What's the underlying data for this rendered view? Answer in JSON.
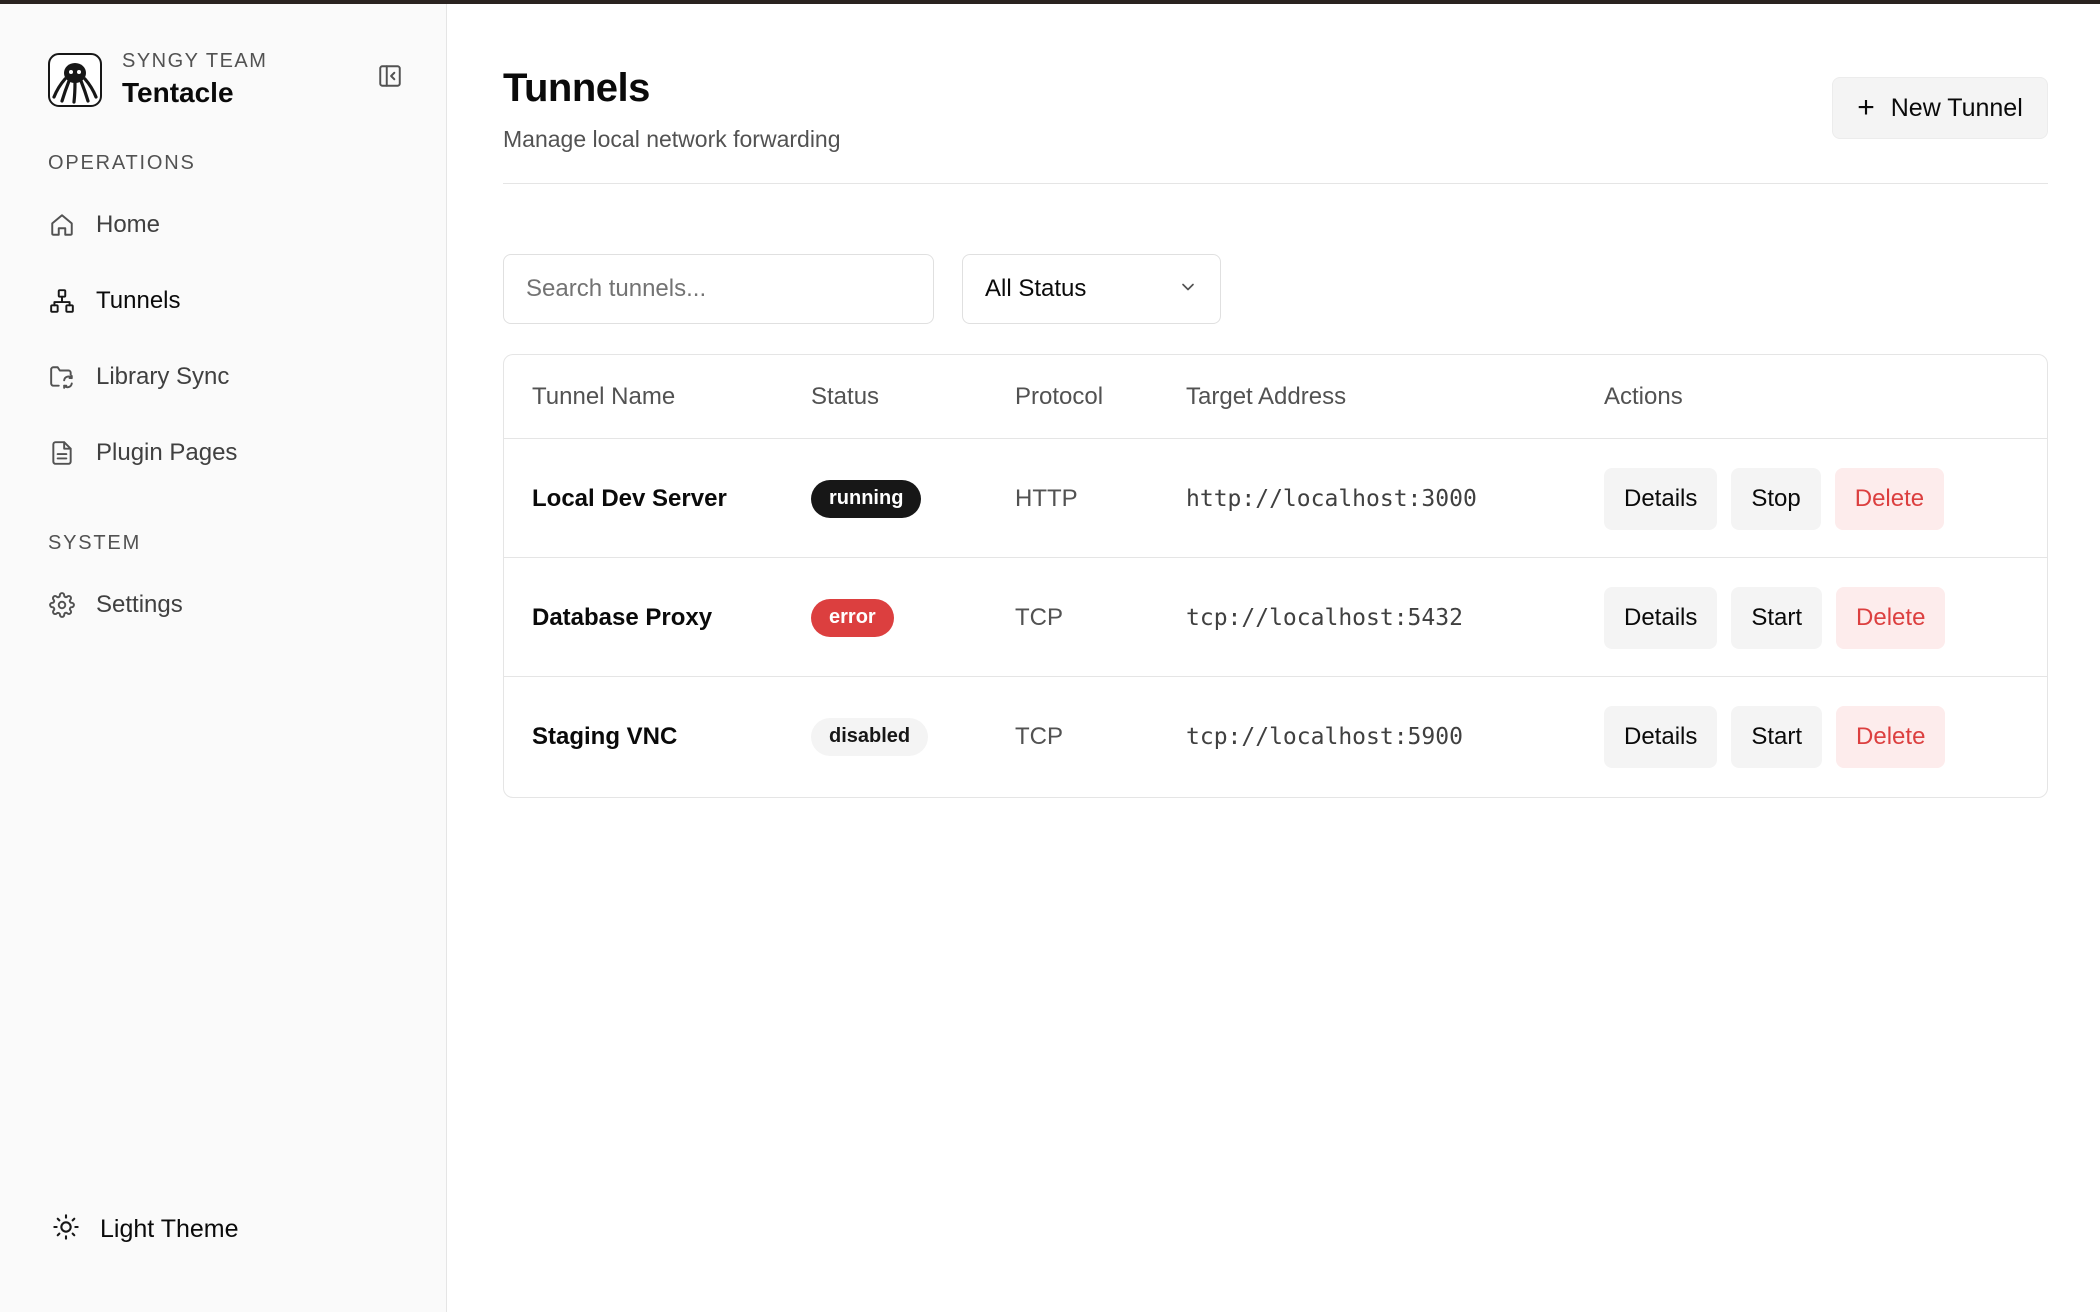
{
  "colors": {
    "accent": "#171717",
    "error": "#dc3f3f",
    "danger_bg": "#fdecec",
    "sidebar_bg": "#fafafa",
    "muted_text": "#525252"
  },
  "sidebar": {
    "team": "SYNGY TEAM",
    "app_name": "Tentacle",
    "logo_icon": "octopus-logo-icon",
    "collapse_icon": "sidebar-collapse-icon",
    "sections": [
      {
        "label": "OPERATIONS",
        "items": [
          {
            "label": "Home",
            "icon": "home-icon",
            "active": false
          },
          {
            "label": "Tunnels",
            "icon": "network-icon",
            "active": true
          },
          {
            "label": "Library Sync",
            "icon": "folder-sync-icon",
            "active": false
          },
          {
            "label": "Plugin Pages",
            "icon": "file-text-icon",
            "active": false
          }
        ]
      },
      {
        "label": "SYSTEM",
        "items": [
          {
            "label": "Settings",
            "icon": "gear-icon",
            "active": false
          }
        ]
      }
    ],
    "theme_toggle": {
      "label": "Light Theme",
      "icon": "sun-icon"
    }
  },
  "header": {
    "title": "Tunnels",
    "subtitle": "Manage local network forwarding",
    "new_button": {
      "icon": "plus-icon",
      "label": "New Tunnel"
    }
  },
  "filters": {
    "search_placeholder": "Search tunnels...",
    "search_value": "",
    "status_selected": "All Status"
  },
  "table": {
    "columns": [
      "Tunnel Name",
      "Status",
      "Protocol",
      "Target Address",
      "Actions"
    ],
    "rows": [
      {
        "name": "Local Dev Server",
        "status": "running",
        "protocol": "HTTP",
        "address": "http://localhost:3000",
        "actions": [
          "Details",
          "Stop",
          "Delete"
        ]
      },
      {
        "name": "Database Proxy",
        "status": "error",
        "protocol": "TCP",
        "address": "tcp://localhost:5432",
        "actions": [
          "Details",
          "Start",
          "Delete"
        ]
      },
      {
        "name": "Staging VNC",
        "status": "disabled",
        "protocol": "TCP",
        "address": "tcp://localhost:5900",
        "actions": [
          "Details",
          "Start",
          "Delete"
        ]
      }
    ]
  }
}
